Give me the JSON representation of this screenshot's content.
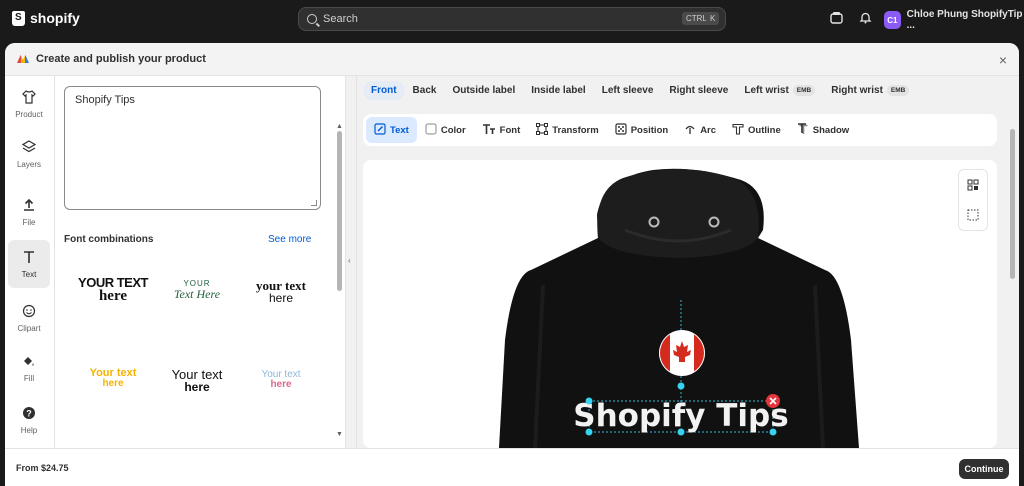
{
  "topbar": {
    "brand": "shopify",
    "search_placeholder": "Search",
    "shortcut_ctrl": "CTRL",
    "shortcut_k": "K",
    "user_initials": "C1",
    "user_name": "Chloe Phung ShopifyTip ..."
  },
  "modal": {
    "title": "Create and publish your product",
    "close": "×"
  },
  "rail": {
    "items": [
      {
        "label": "Product",
        "icon": "shirt-icon"
      },
      {
        "label": "Layers",
        "icon": "layers-icon"
      },
      {
        "label": "File",
        "icon": "upload-icon"
      },
      {
        "label": "Text",
        "icon": "text-icon"
      },
      {
        "label": "Clipart",
        "icon": "smiley-icon"
      },
      {
        "label": "Fill",
        "icon": "paint-bucket-icon"
      },
      {
        "label": "Help",
        "icon": "help-icon"
      }
    ]
  },
  "editor": {
    "text_value": "Shopify Tips",
    "font_combinations_title": "Font combinations",
    "see_more": "See more",
    "combos": [
      {
        "line1": "YOUR TEXT",
        "line2": "here"
      },
      {
        "line1": "YOUR",
        "line2": "Text Here"
      },
      {
        "line1": "your text",
        "line2": "here"
      },
      {
        "line1": "Your text",
        "line2": "here"
      },
      {
        "line1": "Your text",
        "line2": "here"
      },
      {
        "line1": "Your text",
        "line2": "here"
      }
    ]
  },
  "placements": {
    "tabs": [
      {
        "label": "Front",
        "active": true,
        "badge": ""
      },
      {
        "label": "Back",
        "active": false,
        "badge": ""
      },
      {
        "label": "Outside label",
        "active": false,
        "badge": ""
      },
      {
        "label": "Inside label",
        "active": false,
        "badge": ""
      },
      {
        "label": "Left sleeve",
        "active": false,
        "badge": ""
      },
      {
        "label": "Right sleeve",
        "active": false,
        "badge": ""
      },
      {
        "label": "Left wrist",
        "active": false,
        "badge": "EMB"
      },
      {
        "label": "Right wrist",
        "active": false,
        "badge": "EMB"
      }
    ]
  },
  "toolbar": {
    "tools": [
      {
        "label": "Text",
        "icon": "edit-icon",
        "active": true
      },
      {
        "label": "Color",
        "icon": "color-swatch-icon",
        "active": false
      },
      {
        "label": "Font",
        "icon": "font-icon",
        "active": false
      },
      {
        "label": "Transform",
        "icon": "transform-icon",
        "active": false
      },
      {
        "label": "Position",
        "icon": "position-icon",
        "active": false
      },
      {
        "label": "Arc",
        "icon": "arc-icon",
        "active": false
      },
      {
        "label": "Outline",
        "icon": "outline-icon",
        "active": false
      },
      {
        "label": "Shadow",
        "icon": "shadow-icon",
        "active": false
      }
    ]
  },
  "canvas": {
    "design_text": "Shopify Tips",
    "product_color": "#111111",
    "flag_red": "#d52b1e"
  },
  "footer": {
    "price": "From $24.75",
    "continue": "Continue"
  }
}
